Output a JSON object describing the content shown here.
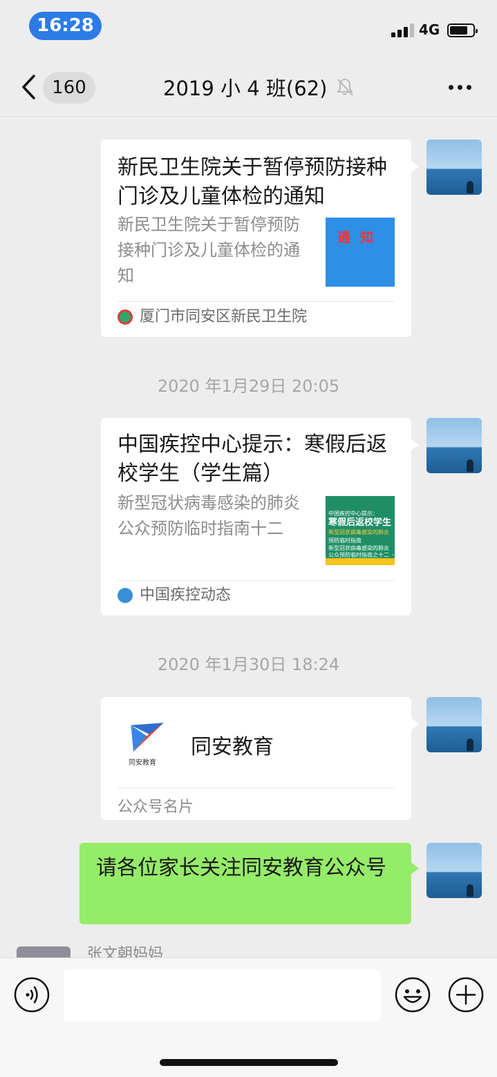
{
  "status_bar": {
    "time": "16:28",
    "network": "4G",
    "battery_level": 0.78
  },
  "nav": {
    "unread_count": "160",
    "title": "2019 小 4 班(62)"
  },
  "messages": [
    {
      "type": "article",
      "title": "新民卫生院关于暂停预防接种门诊及儿童体检的通知",
      "description": "新民卫生院关于暂停预防接种门诊及儿童体检的通知",
      "thumbnail_text": "通知",
      "source": "厦门市同安区新民卫生院"
    },
    {
      "type": "timestamp",
      "text": "2020 年1月29日 20:05"
    },
    {
      "type": "article",
      "title": "中国疾控中心提示：寒假后返校学生（学生篇）",
      "description": "新型冠状病毒感染的肺炎公众预防临时指南十二",
      "thumbnail_lines": [
        "中国疾控中心提示：",
        "寒假后返校学生",
        "新型冠状病毒感染的肺炎",
        "预防临时指南",
        "新型冠状病毒感染的肺炎",
        "公众预防临时指南之十二（学生篇）"
      ],
      "source": "中国疾控动态"
    },
    {
      "type": "timestamp",
      "text": "2020 年1月30日 18:24"
    },
    {
      "type": "contact_card",
      "logo_caption": "同安教育",
      "name": "同安教育",
      "footer": "公众号名片"
    },
    {
      "type": "text",
      "text": "请各位家长关注同安教育公众号"
    },
    {
      "type": "incoming",
      "sender": "张文朝妈妈"
    }
  ],
  "input_bar": {
    "value": ""
  },
  "colors": {
    "accent": "#2d7be5",
    "bubble": "#95ec69",
    "background": "#ededed"
  }
}
